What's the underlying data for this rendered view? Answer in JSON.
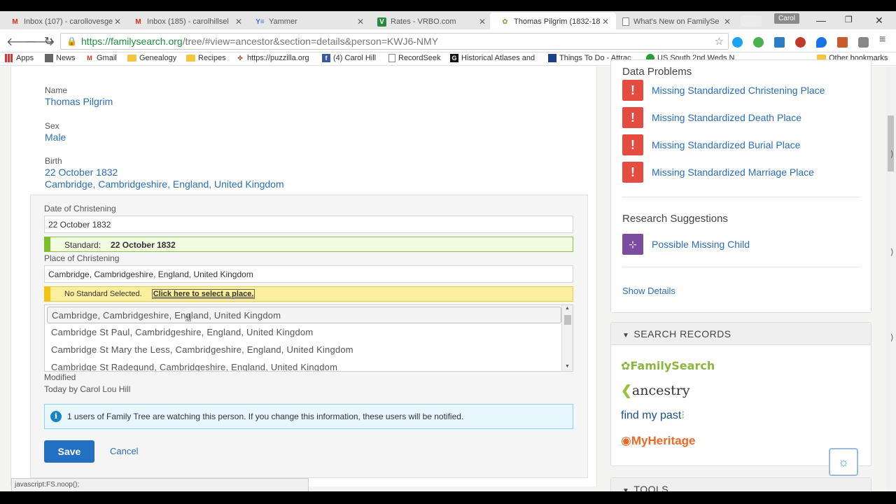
{
  "browser": {
    "tabs": [
      {
        "icon": "gmail-icon",
        "glyph": "M",
        "title": "Inbox (107) - carollovesge",
        "active": false
      },
      {
        "icon": "gmail-icon",
        "glyph": "M",
        "title": "Inbox (185) - carolhillsel",
        "active": false
      },
      {
        "icon": "yammer-icon",
        "glyph": "Y≡",
        "title": "Yammer",
        "active": false
      },
      {
        "icon": "vrbo-icon",
        "glyph": "V",
        "title": "Rates - VRBO.com",
        "active": false
      },
      {
        "icon": "familysearch-tree-icon",
        "glyph": "✿",
        "title": "Thomas Pilgrim (1832-18",
        "active": true
      },
      {
        "icon": "document-icon",
        "glyph": "",
        "title": "What's New on FamilySe",
        "active": false
      }
    ],
    "profile_name": "Carol",
    "url_host": "https://familysearch.org",
    "url_rest": "/tree/#view=ancestor&section=details&person=KWJ6-NMY",
    "bookmarks": [
      {
        "label": "Apps",
        "icon": "apps-grid-icon"
      },
      {
        "label": "News",
        "icon": "news-icon"
      },
      {
        "label": "Gmail",
        "icon": "gmail-icon"
      },
      {
        "label": "Genealogy",
        "icon": "folder-icon"
      },
      {
        "label": "Recipes",
        "icon": "folder-icon"
      },
      {
        "label": "https://puzzilla.org",
        "icon": "puzzilla-icon"
      },
      {
        "label": "(4) Carol Hill",
        "icon": "facebook-icon"
      },
      {
        "label": "RecordSeek",
        "icon": "document-icon"
      },
      {
        "label": "Historical Atlases and",
        "icon": "ghl-icon"
      },
      {
        "label": "Things To Do - Attrac",
        "icon": "monitor-icon"
      },
      {
        "label": "US South 2nd Weds N",
        "icon": "green-circle-icon"
      },
      {
        "label": "Other bookmarks",
        "icon": "folder-icon"
      }
    ],
    "status_text": "javascript:FS.noop();"
  },
  "person": {
    "name_label": "Name",
    "name": "Thomas Pilgrim",
    "sex_label": "Sex",
    "sex": "Male",
    "birth_label": "Birth",
    "birth_date": "22 October 1832",
    "birth_place": "Cambridge, Cambridgeshire, England, United Kingdom"
  },
  "edit": {
    "date_label": "Date of Christening",
    "date_value": "22 October 1832",
    "standard_label": "Standard:",
    "standard_value": "22 October 1832",
    "place_label": "Place of Christening",
    "place_value": "Cambridge, Cambridgeshire, England, United Kingdom",
    "no_standard_text": "No Standard Selected.",
    "select_place_link": "Click here to select a place.",
    "suggestions": [
      "Cambridge, Cambridgeshire, England, United Kingdom",
      "Cambridge St Paul, Cambridgeshire, England, United Kingdom",
      "Cambridge St Mary the Less, Cambridgeshire, England, United Kingdom",
      "Cambridge St Radegund, Cambridgeshire, England, United Kingdom"
    ],
    "modified_label": "Modified",
    "modified_value": "Today by Carol Lou Hill",
    "info_text": "1 users of Family Tree are watching this person. If you change this information, these users will be notified.",
    "save_label": "Save",
    "cancel_label": "Cancel"
  },
  "sidebar": {
    "data_problems_title": "Data Problems",
    "problems": [
      "Missing Standardized Christening Place",
      "Missing Standardized Death Place",
      "Missing Standardized Burial Place",
      "Missing Standardized Marriage Place"
    ],
    "research_title": "Research Suggestions",
    "research_item": "Possible Missing Child",
    "show_details": "Show Details",
    "search_records_title": "SEARCH RECORDS",
    "record_sites": {
      "familysearch": "FamilySearch",
      "ancestry": "ancestry",
      "findmypast": "find my past",
      "myheritage": "MyHeritage"
    },
    "tools_title": "TOOLS"
  }
}
